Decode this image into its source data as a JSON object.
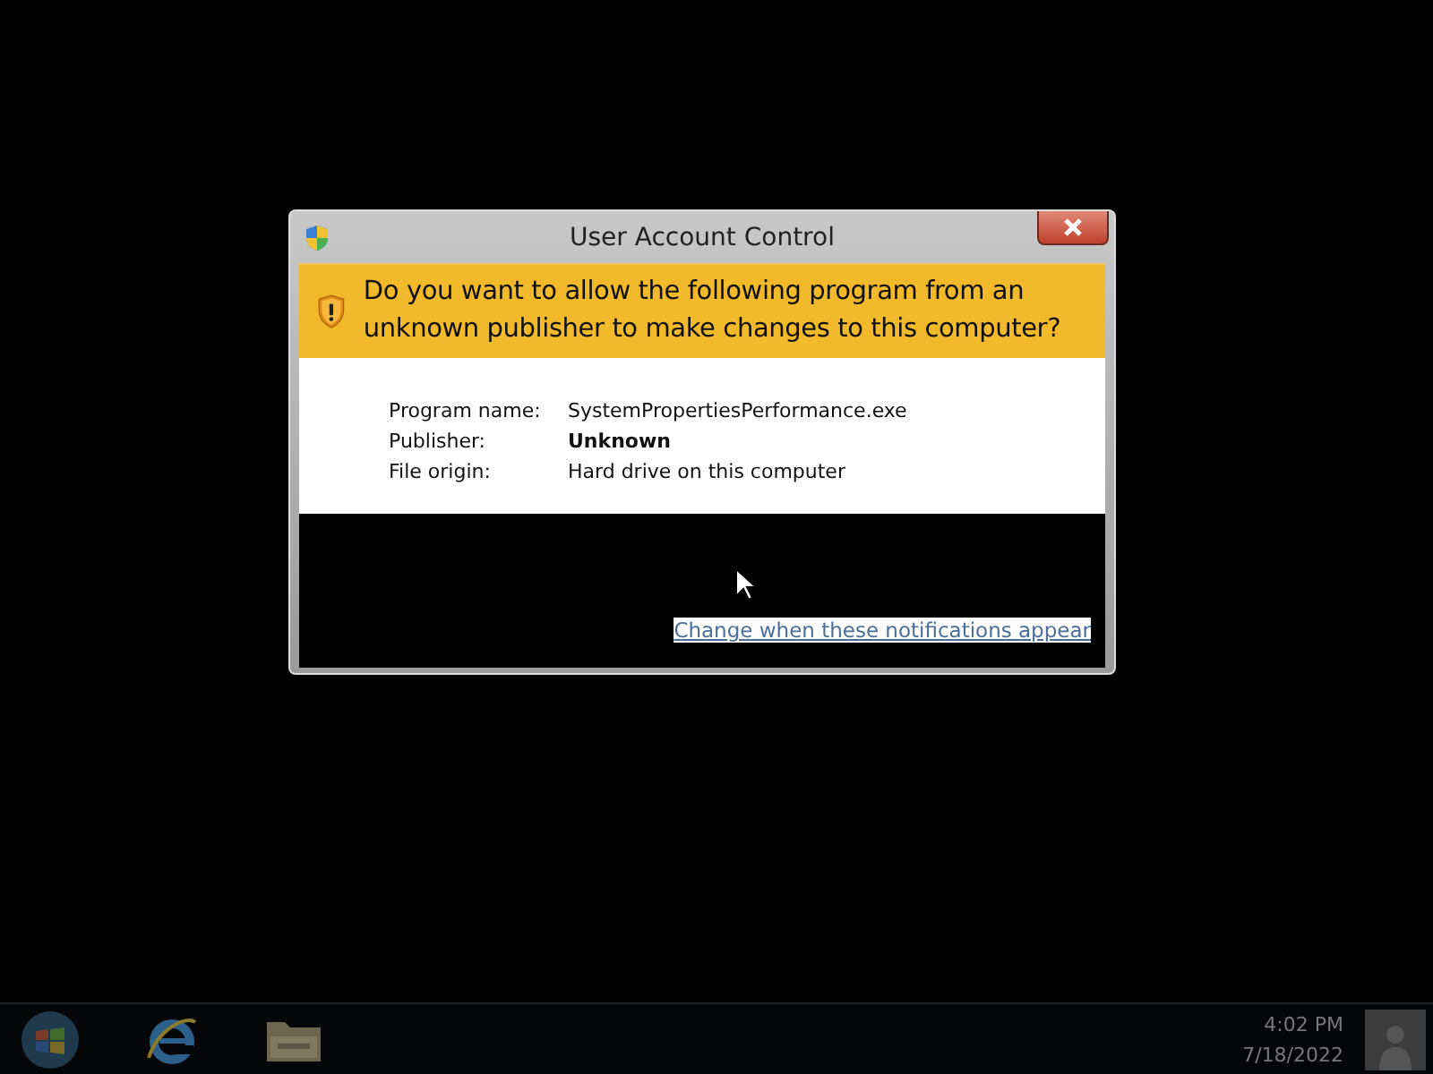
{
  "window": {
    "title": "User Account Control"
  },
  "question": "Do you want to allow the following program from an unknown publisher to make changes to this computer?",
  "details": [
    {
      "label": "Program name:",
      "value": "SystemPropertiesPerformance.exe",
      "kind": "plain"
    },
    {
      "label": "Publisher:",
      "value": "Unknown",
      "kind": "bold"
    },
    {
      "label": "File origin:",
      "value": "Hard drive on this computer",
      "kind": "plain"
    }
  ],
  "link": "Change when these notifications appear",
  "taskbar": {
    "time": "4:02 PM",
    "date": "7/18/2022"
  }
}
